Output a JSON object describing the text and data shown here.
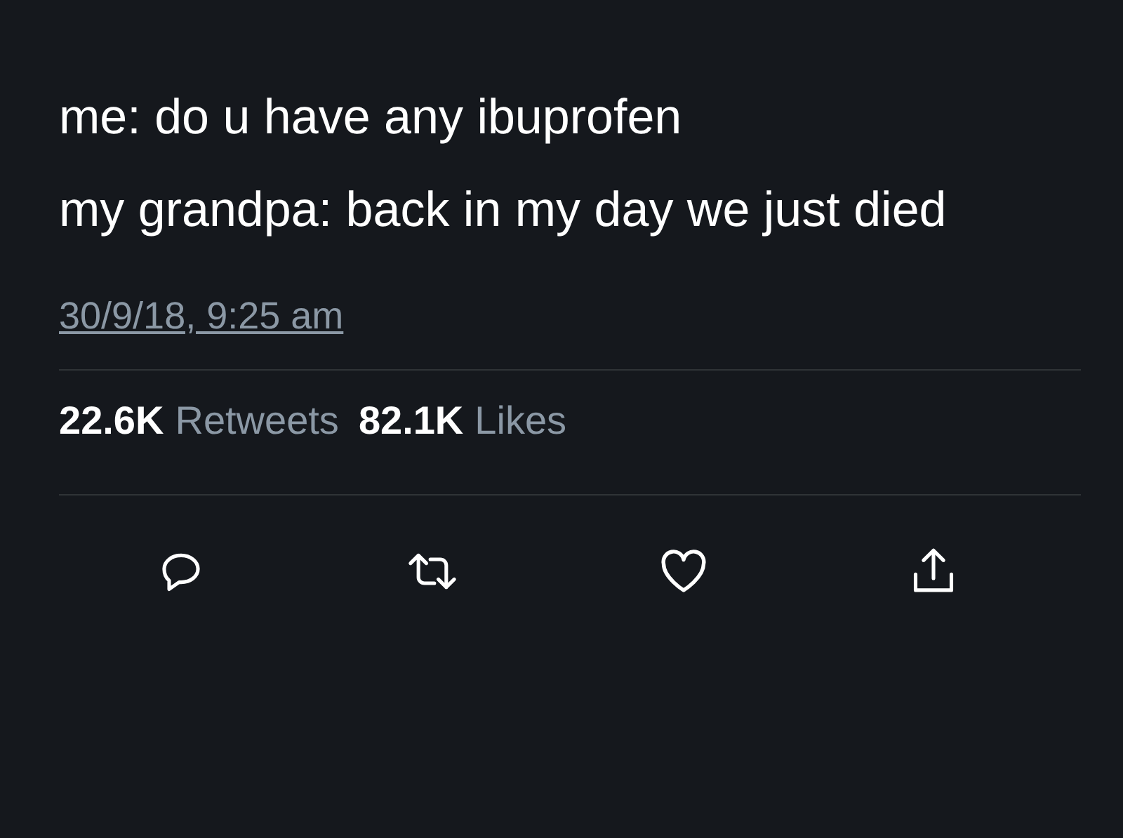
{
  "tweet": {
    "paragraphs": [
      "me: do u have any ibuprofen",
      "my grandpa: back in my day we just died"
    ],
    "timestamp": "30/9/18, 9:25 am"
  },
  "stats": [
    {
      "count": "22.6K",
      "label": "Retweets"
    },
    {
      "count": "82.1K",
      "label": "Likes"
    }
  ],
  "actions": [
    {
      "kind": "reply"
    },
    {
      "kind": "retweet"
    },
    {
      "kind": "like"
    },
    {
      "kind": "share"
    }
  ]
}
